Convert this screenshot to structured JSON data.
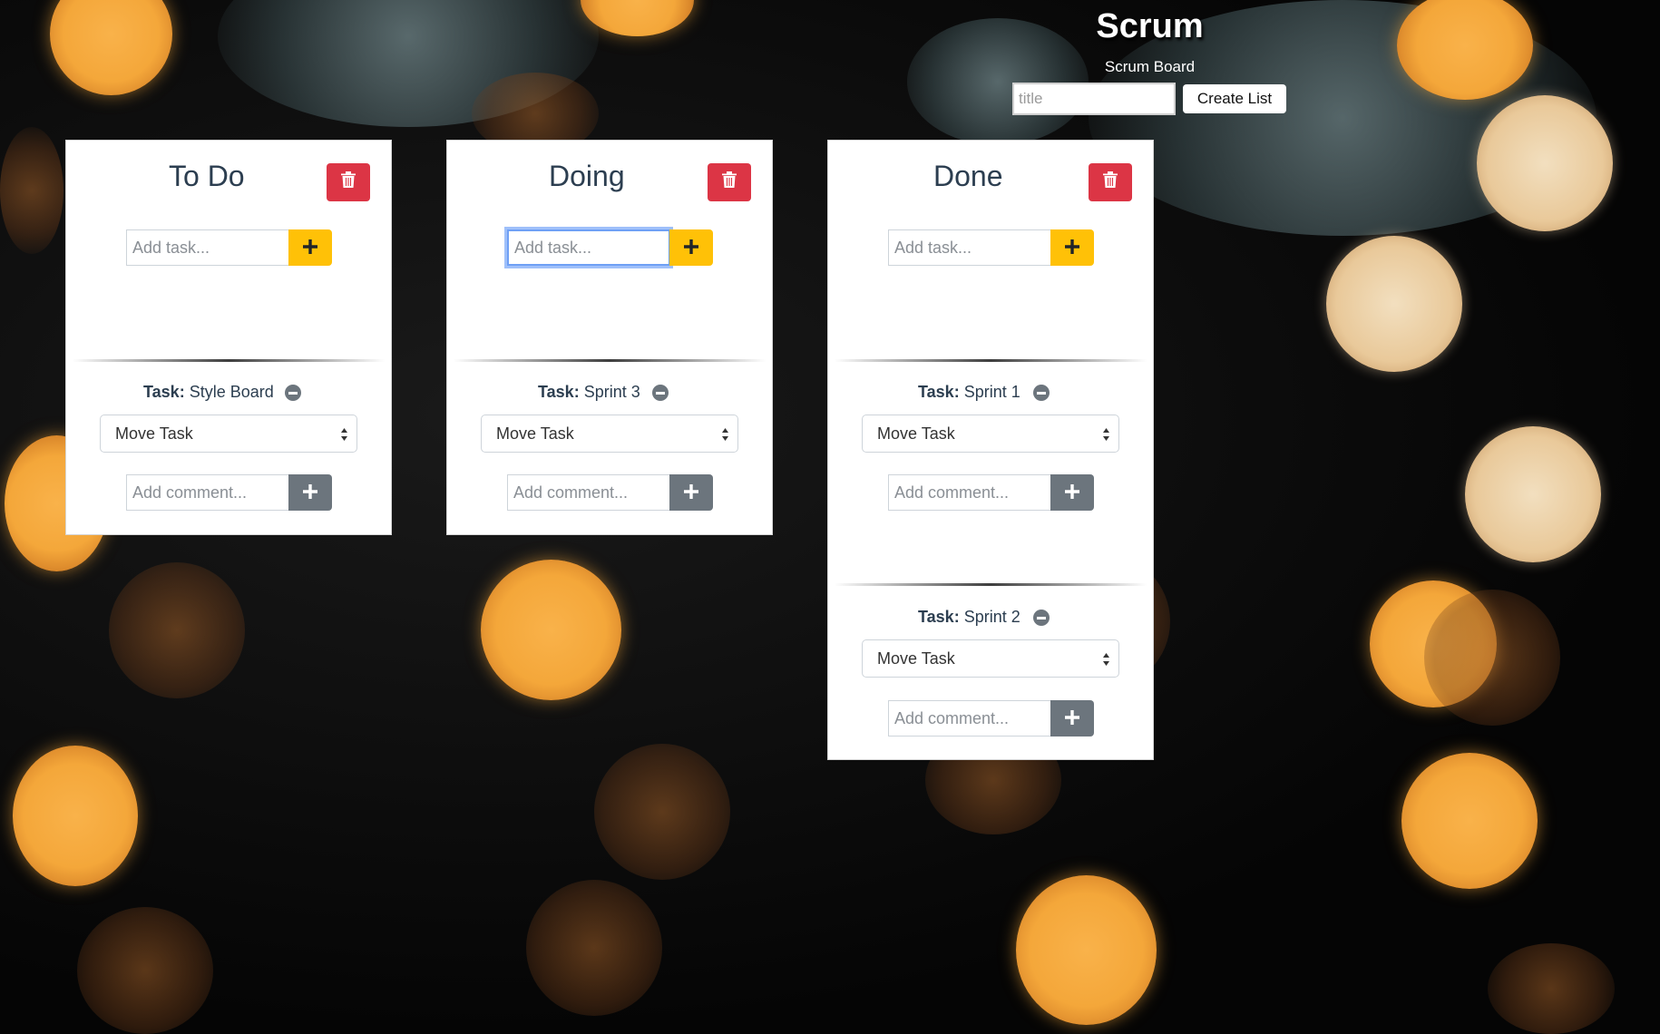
{
  "header": {
    "title": "Scrum",
    "subtitle": "Scrum Board",
    "title_input_placeholder": "title",
    "create_list_label": "Create List"
  },
  "lists": [
    {
      "title": "To Do",
      "add_task_placeholder": "Add task...",
      "tasks": [
        {
          "label": "Task:",
          "name": "Style Board",
          "move_label": "Move Task",
          "comment_placeholder": "Add comment..."
        }
      ]
    },
    {
      "title": "Doing",
      "add_task_placeholder": "Add task...",
      "tasks": [
        {
          "label": "Task:",
          "name": "Sprint 3",
          "move_label": "Move Task",
          "comment_placeholder": "Add comment..."
        }
      ]
    },
    {
      "title": "Done",
      "add_task_placeholder": "Add task...",
      "tasks": [
        {
          "label": "Task:",
          "name": "Sprint 1",
          "move_label": "Move Task",
          "comment_placeholder": "Add comment..."
        },
        {
          "label": "Task:",
          "name": "Sprint 2",
          "move_label": "Move Task",
          "comment_placeholder": "Add comment..."
        }
      ]
    }
  ],
  "icons": {
    "delete": "trash-icon",
    "add": "plus-icon",
    "remove_task": "minus-circle-icon",
    "select": "select-arrows-icon"
  },
  "colors": {
    "delete_button": "#dc3545",
    "add_task_button": "#ffc107",
    "add_comment_button": "#6c757d",
    "list_title": "#2c3e50",
    "focus_ring": "#6fa0f5"
  }
}
